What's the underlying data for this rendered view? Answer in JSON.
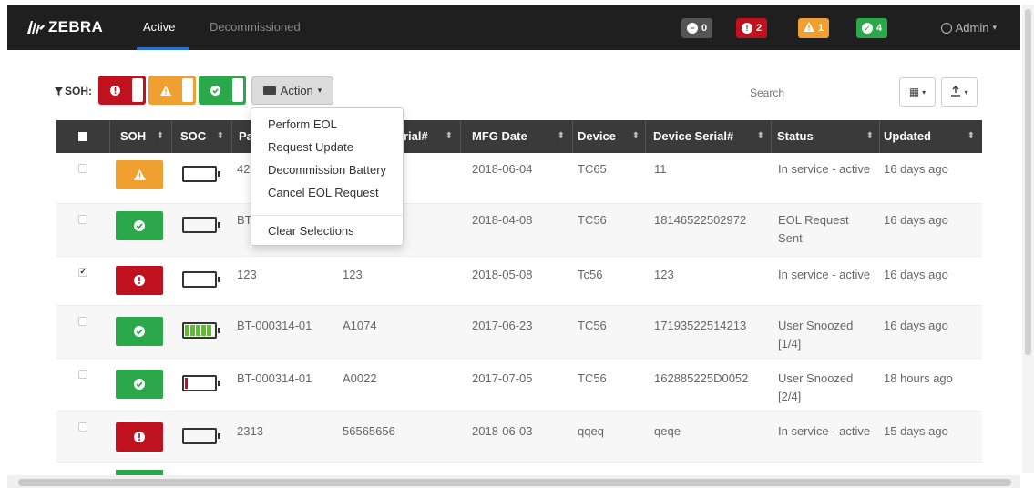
{
  "brand": {
    "name": "ZEBRA"
  },
  "nav": {
    "tab_active": "Active",
    "tab_decommissioned": "Decommissioned"
  },
  "badges": [
    {
      "icon": "minus-circle-icon",
      "count": "0",
      "color": "#555555"
    },
    {
      "icon": "exclamation-circle-icon",
      "count": "2",
      "color": "#c0111f"
    },
    {
      "icon": "warning-triangle-icon",
      "count": "1",
      "color": "#f0a030"
    },
    {
      "icon": "check-circle-icon",
      "count": "4",
      "color": "#2aa84a"
    }
  ],
  "user": {
    "label": "Admin"
  },
  "toolbar": {
    "soh_label": "SOH:",
    "action_label": "Action",
    "search_placeholder": "Search"
  },
  "colors": {
    "red": "#c0111f",
    "orange": "#f0a030",
    "green": "#2aa84a",
    "header": "#3a3a3a"
  },
  "action_menu": {
    "items": [
      "Perform EOL",
      "Request Update",
      "Decommission Battery",
      "Cancel EOL Request"
    ],
    "clear": "Clear Selections"
  },
  "table": {
    "headers": {
      "soh": "SOH",
      "soc": "SOC",
      "part": "Pa",
      "serial": "rial#",
      "mfg": "MFG Date",
      "device": "Device",
      "device_serial": "Device Serial#",
      "status": "Status",
      "updated": "Updated"
    },
    "rows": [
      {
        "checked": false,
        "soh": "warning",
        "soc_level": 0,
        "part": "42",
        "serial": "",
        "mfg": "2018-06-04",
        "device": "TC65",
        "device_serial": "11",
        "status": "In service - active",
        "updated": "16 days ago"
      },
      {
        "checked": false,
        "soh": "good",
        "soc_level": 0,
        "part": "BT",
        "serial": "",
        "mfg": "2018-04-08",
        "device": "TC56",
        "device_serial": "18146522502972",
        "status": "EOL Request Sent",
        "updated": "16 days ago"
      },
      {
        "checked": true,
        "soh": "bad",
        "soc_level": 0,
        "part": "123",
        "serial": "123",
        "mfg": "2018-05-08",
        "device": "Tc56",
        "device_serial": "123",
        "status": "In service - active",
        "updated": "16 days ago"
      },
      {
        "checked": false,
        "soh": "good",
        "soc_level": 1.0,
        "part": "BT-000314-01",
        "serial": "A1074",
        "mfg": "2017-06-23",
        "device": "TC56",
        "device_serial": "17193522514213",
        "status": "User Snoozed [1/4]",
        "updated": "16 days ago"
      },
      {
        "checked": false,
        "soh": "good",
        "soc_level": 0.1,
        "part": "BT-000314-01",
        "serial": "A0022",
        "mfg": "2017-07-05",
        "device": "TC56",
        "device_serial": "162885225D0052",
        "status": "User Snoozed [2/4]",
        "updated": "18 hours ago"
      },
      {
        "checked": false,
        "soh": "bad",
        "soc_level": 0,
        "part": "2313",
        "serial": "56565656",
        "mfg": "2018-06-03",
        "device": "qqeq",
        "device_serial": "qeqe",
        "status": "In service - active",
        "updated": "15 days ago"
      }
    ]
  }
}
